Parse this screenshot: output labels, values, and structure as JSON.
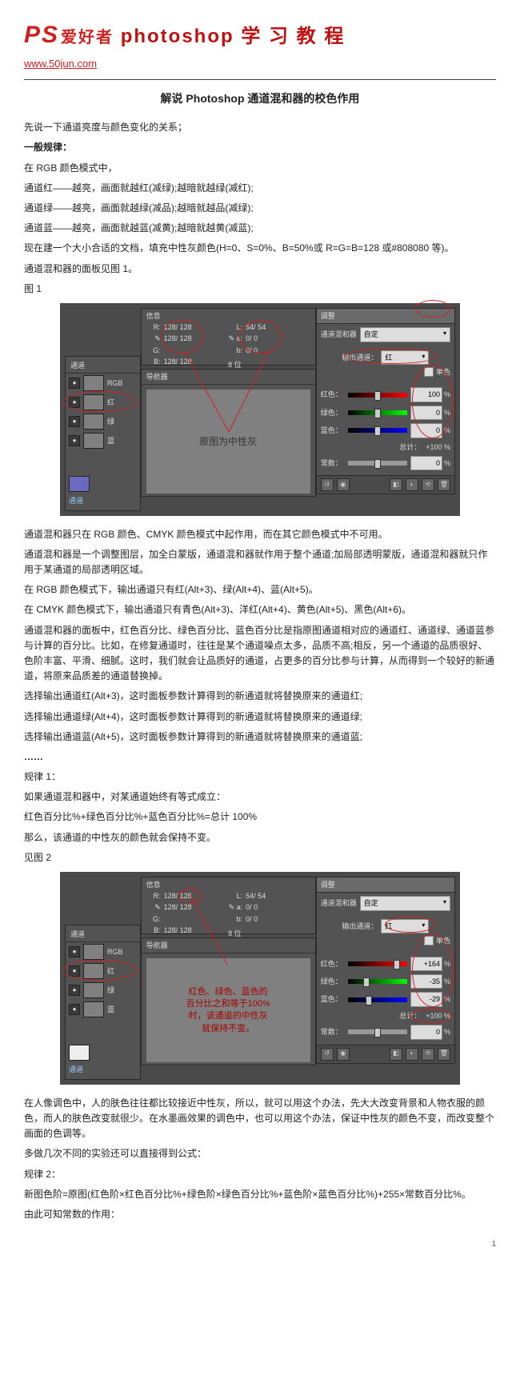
{
  "site": {
    "brand_ps": "PS",
    "brand_cn": "爱好者",
    "brand_en": "photoshop 学 习 教 程",
    "url": "www.50jun.com"
  },
  "article": {
    "title": "解说 Photoshop 通道混和器的校色作用",
    "body": [
      "先说一下通道亮度与颜色变化的关系；",
      "一般规律：",
      "在 RGB 颜色模式中，",
      "通道红——越亮，画面就越红(减绿);越暗就越绿(减红);",
      "通道绿——越亮，画面就越绿(减品);越暗就越品(减绿);",
      "通道蓝——越亮，画面就越蓝(减黄);越暗就越黄(减蓝);",
      "现在建一个大小合适的文档，填充中性灰颜色(H=0、S=0%、B=50%或 R=G=B=128 或#808080 等)。",
      "通道混和器的面板见图 1。",
      "图 1"
    ],
    "after_fig1": [
      "通道混和器只在 RGB 颜色、CMYK 颜色模式中起作用，而在其它颜色模式中不可用。",
      "通道混和器是一个调整图层，加全白蒙版，通道混和器就作用于整个通道;加局部透明蒙版，通道混和器就只作用于某通道的局部透明区域。",
      "在 RGB 颜色模式下，输出通道只有红(Alt+3)、绿(Alt+4)、蓝(Alt+5)。",
      "在 CMYK 颜色模式下，输出通道只有青色(Alt+3)、洋红(Alt+4)、黄色(Alt+5)、黑色(Alt+6)。",
      "通道混和器的面板中，红色百分比、绿色百分比、蓝色百分比是指原图通道相对应的通道红、通道绿、通道蓝参与计算的百分比。比如，在修复通道时，往往是某个通道噪点太多，品质不高;相反，另一个通道的品质很好、色阶丰富、平滑、细腻。这时，我们就会让品质好的通道，占更多的百分比参与计算，从而得到一个较好的新通道，将原来品质差的通道替换掉。",
      "选择输出通道红(Alt+3)，这时面板参数计算得到的新通道就将替换原来的通道红;",
      "选择输出通道绿(Alt+4)，这时面板参数计算得到的新通道就将替换原来的通道绿;",
      "选择输出通道蓝(Alt+5)，这时面板参数计算得到的新通道就将替换原来的通道蓝;",
      "……",
      "规律 1：",
      "如果通道混和器中，对某通道始终有等式成立：",
      "红色百分比%+绿色百分比%+蓝色百分比%=总计 100%",
      "那么，该通道的中性灰的颜色就会保持不变。",
      "见图 2"
    ],
    "after_fig2": [
      "在人像调色中，人的肤色往往都比较接近中性灰，所以，就可以用这个办法，先大大改变背景和人物衣服的颜色，而人的肤色改变就很少。在水墨画效果的调色中，也可以用这个办法，保证中性灰的颜色不变，而改变整个画面的色调等。",
      "多做几次不同的实验还可以直接得到公式：",
      "规律 2：",
      "新图色阶=原图(红色阶×红色百分比%+绿色阶×绿色百分比%+蓝色阶×蓝色百分比%)+255×常数百分比%。",
      "由此可知常数的作用："
    ]
  },
  "fig1": {
    "channels_tab": "通道",
    "channels": [
      "RGB",
      "红",
      "绿",
      "蓝"
    ],
    "info_title": "信息",
    "info_left": {
      "R": "128/ 128",
      "G": "128/ 128",
      "B": "128/ 128",
      "bits": "8 位"
    },
    "info_right": {
      "L": "54/ 54",
      "a": "0/ 0",
      "b": "0/ 0",
      "bits": "8 位"
    },
    "nav_title": "导航器",
    "nav_text": "原图为中性灰",
    "adj_tab": "调整",
    "mixer_title": "通道混和器",
    "preset": "自定",
    "output_label": "输出通道：",
    "output_value": "红",
    "mono_label": "单色",
    "sliders": {
      "red": {
        "label": "红色：",
        "value": "100",
        "pos": 50
      },
      "green": {
        "label": "绿色：",
        "value": "0",
        "pos": 50
      },
      "blue": {
        "label": "蓝色：",
        "value": "0",
        "pos": 50
      }
    },
    "total_label": "总计：",
    "total_value": "+100 %",
    "const_label": "常数：",
    "const_value": "0",
    "ch_thumb": "通道"
  },
  "fig2": {
    "info_left": {
      "R": "128/ 128",
      "G": "128/ 128",
      "B": "128/ 128",
      "bits": "8 位"
    },
    "info_right": {
      "L": "54/ 54",
      "a": "0/ 0",
      "b": "0/ 0",
      "bits": "8 位"
    },
    "nav_text1": "红色、绿色、蓝色的",
    "nav_text2": "百分比之和等于100%",
    "nav_text3": "时，该通道的中性灰",
    "nav_text4": "就保持不变。",
    "preset": "自定",
    "output_value": "红",
    "sliders": {
      "red": {
        "label": "红色：",
        "value": "+164",
        "pos": 82
      },
      "green": {
        "label": "绿色：",
        "value": "-35",
        "pos": 32
      },
      "blue": {
        "label": "蓝色：",
        "value": "-29",
        "pos": 35
      }
    },
    "total_value": "+100 %",
    "const_value": "0"
  },
  "pagenum": "1"
}
